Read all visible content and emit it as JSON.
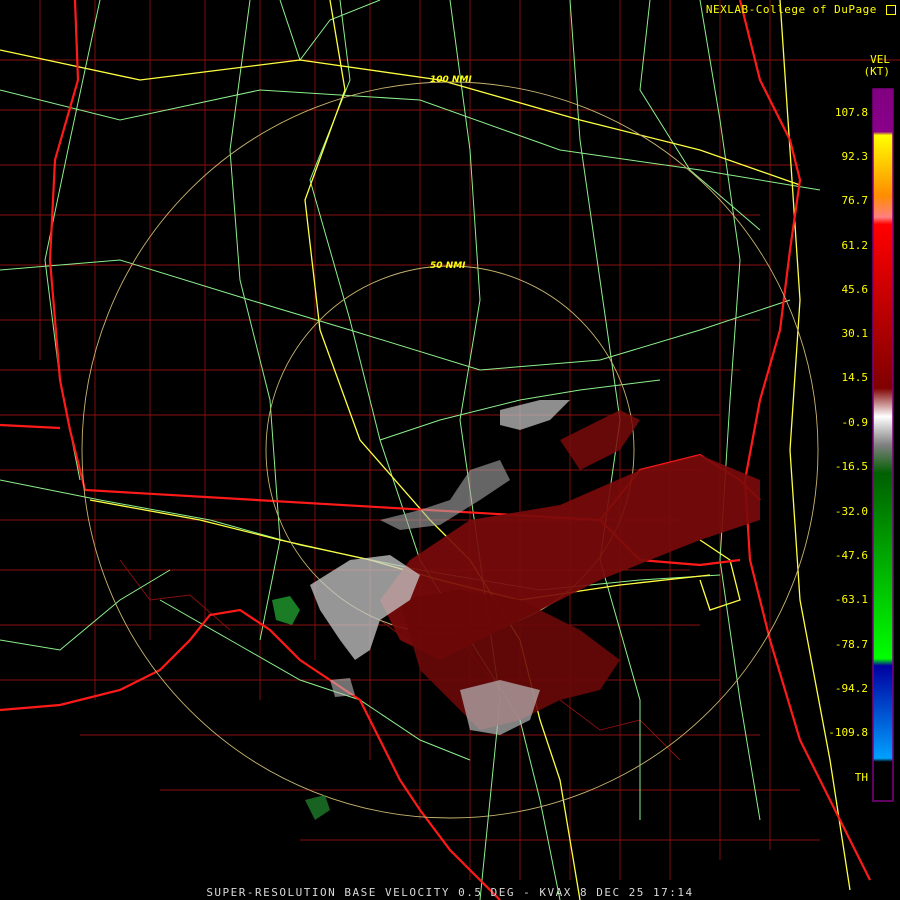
{
  "credit": "NEXLAB-College of DuPage",
  "product_line": "SUPER-RESOLUTION BASE VELOCITY 0.5 DEG - KVAX 8 DEC 25 17:14",
  "scale": {
    "title": "VEL",
    "unit": "(KT)",
    "ticks": [
      "107.8",
      "92.3",
      "76.7",
      "61.2",
      "45.6",
      "30.1",
      "14.5",
      "-0.9",
      "-16.5",
      "-32.0",
      "-47.6",
      "-63.1",
      "-78.7",
      "-94.2",
      "-109.8",
      "TH"
    ]
  },
  "range_rings": [
    {
      "label": "100 NMI"
    },
    {
      "label": "50 NMI"
    }
  ],
  "colors": {
    "background": "#000000",
    "county_lines": "#8a0f0f",
    "state_lines": "#ff1a1a",
    "highways": "#8cf08c",
    "interstates": "#ffff40",
    "range_rings": "#c8b46e",
    "text": "#ffff00",
    "inbound_velocity": "#7a0a0a",
    "near_zero_velocity": "#c8c8c8",
    "outbound_velocity": "#1e8a2a"
  },
  "icons": [
    "logo-icon"
  ]
}
